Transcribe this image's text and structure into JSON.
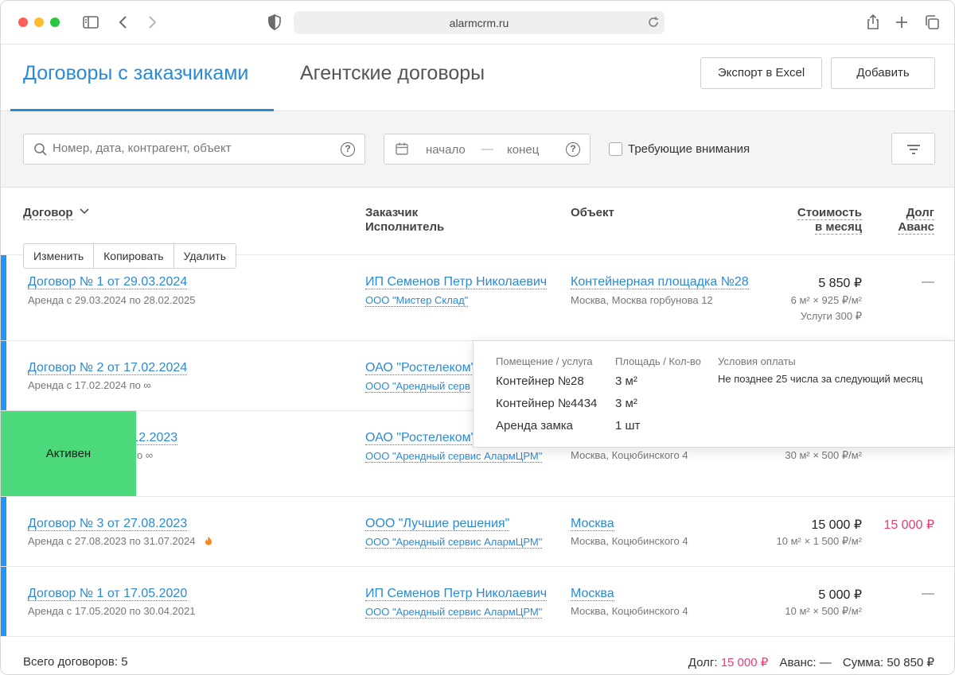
{
  "browser": {
    "url": "alarmcrm.ru"
  },
  "tabs": {
    "active": "Договоры с заказчиками",
    "inactive": "Агентские договоры"
  },
  "toolbar": {
    "export_label": "Экспорт в Excel",
    "add_label": "Добавить"
  },
  "filters": {
    "search_placeholder": "Номер, дата, контрагент, объект",
    "date_start": "начало",
    "date_sep": "—",
    "date_end": "конец",
    "attention_label": "Требующие внимания"
  },
  "table": {
    "headers": {
      "contract": "Договор",
      "customer": "Заказчик",
      "executor": "Исполнитель",
      "object": "Объект",
      "cost_line1": "Стоимость",
      "cost_line2": "в месяц",
      "debt_line1": "Долг",
      "debt_line2": "Аванс"
    },
    "row_actions": [
      "Изменить",
      "Копировать",
      "Удалить"
    ],
    "rows": [
      {
        "title": "Договор № 1 от 29.03.2024",
        "period": "Аренда с 29.03.2024 по 28.02.2025",
        "customer": "ИП Семенов Петр Николаевич",
        "executor": "ООО \"Мистер Склад\"",
        "object": "Контейнерная площадка №28",
        "address": "Москва, Москва горбунова 12",
        "price": "5 850 ₽",
        "detail1": "6 м² × 925 ₽/м²",
        "detail2": "Услуги 300 ₽",
        "debt": "—"
      },
      {
        "title": "Договор № 2 от 17.02.2024",
        "period": "Аренда с 17.02.2024 по ∞",
        "customer": "ОАО \"Ростелеком\"",
        "executor": "ООО \"Арендный серв",
        "object": "",
        "address": "",
        "price": "",
        "detail1": "",
        "detail2": "",
        "debt": ""
      },
      {
        "title": "5.12.2023",
        "period": "по ∞",
        "customer": "ОАО \"Ростелеком\"",
        "executor": "ООО \"Арендный сервис АлармЦРМ\"",
        "object": "",
        "address": "Москва, Коцюбинского 4",
        "price": "",
        "detail1": "30 м² × 500 ₽/м²",
        "detail2": "",
        "debt": ""
      },
      {
        "title": "Договор № 3 от 27.08.2023",
        "period": "Аренда с 27.08.2023 по 31.07.2024",
        "customer": "ООО \"Лучшие решения\"",
        "executor": "ООО \"Арендный сервис АлармЦРМ\"",
        "object": "Москва",
        "address": "Москва, Коцюбинского 4",
        "price": "15 000 ₽",
        "detail1": "10 м² × 1 500 ₽/м²",
        "detail2": "",
        "debt": "15 000 ₽"
      },
      {
        "title": "Договор № 1 от 17.05.2020",
        "period": "Аренда с 17.05.2020 по 30.04.2021",
        "customer": "ИП Семенов Петр Николаевич",
        "executor": "ООО \"Арендный сервис АлармЦРМ\"",
        "object": "Москва",
        "address": "Москва, Коцюбинского 4",
        "price": "5 000 ₽",
        "detail1": "10 м² × 500 ₽/м²",
        "detail2": "",
        "debt": "—"
      }
    ]
  },
  "status_overlay": "Активен",
  "popover": {
    "headers": {
      "item": "Помещение / услуга",
      "qty": "Площадь / Кол-во",
      "terms": "Условия оплаты"
    },
    "items": [
      {
        "name": "Контейнер №28",
        "qty": "3 м²"
      },
      {
        "name": "Контейнер №4434",
        "qty": "3 м²"
      },
      {
        "name": "Аренда замка",
        "qty": "1 шт"
      }
    ],
    "terms": "Не позднее 25 числа за следующий месяц"
  },
  "footer": {
    "total_label": "Всего договоров: 5",
    "debt_label": "Долг:",
    "debt_value": "15 000 ₽",
    "advance_label": "Аванс:",
    "advance_value": "—",
    "sum_label": "Сумма:",
    "sum_value": "50 850 ₽"
  },
  "colors": {
    "accent": "#2a8ad6",
    "row_bar": "#2196f3",
    "debt": "#e83d7a",
    "status_active": "#4cd97b"
  }
}
